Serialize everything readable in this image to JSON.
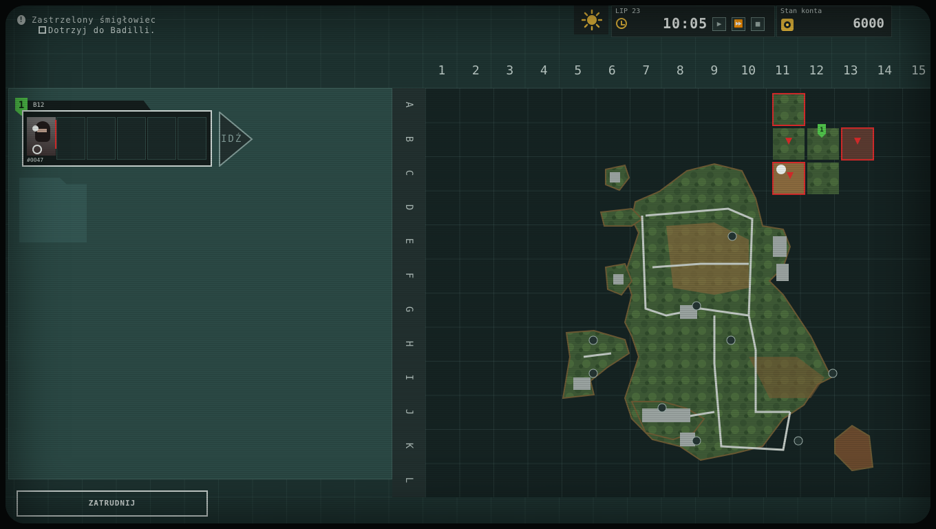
{
  "notification": {
    "title": "Zastrzelony śmigłowiec",
    "objective": "Dotrzyj do Badilli."
  },
  "hud": {
    "weather_icon": "sun-icon",
    "date": "LIP 23",
    "time": "10:05",
    "controls": [
      "play-icon",
      "fast-forward-icon",
      "stop-icon"
    ],
    "balance_label": "Stan konta",
    "balance": "6000"
  },
  "map": {
    "columns": [
      "1",
      "2",
      "3",
      "4",
      "5",
      "6",
      "7",
      "8",
      "9",
      "10",
      "11",
      "12",
      "13",
      "14",
      "15"
    ],
    "rows": [
      "A",
      "B",
      "C",
      "D",
      "E",
      "F",
      "G",
      "H",
      "I",
      "J",
      "K",
      "L"
    ],
    "squad_marker": "1",
    "colors": {
      "enemy": "#d62a2a",
      "friendly": "#4fc04a",
      "island": "#3e5a36"
    }
  },
  "squad": {
    "number": "1",
    "location": "B12",
    "merc_id": "#0047",
    "go_label": "IDŹ"
  },
  "hire_button": "ZATRUDNIJ"
}
